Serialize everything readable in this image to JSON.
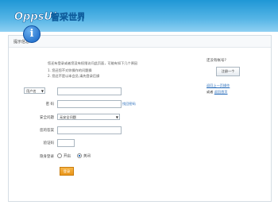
{
  "header": {
    "logo_text": "OppsU! 智采世界"
  },
  "panel": {
    "title": "提示信息"
  },
  "message": {
    "line1": "您还有登录或者您没有权限访问此页面，可能有如下几个原因",
    "line2": "1. 您还您不对你操作的问题操",
    "line3": "2. 您还不是以本会员,请先登录后操"
  },
  "form": {
    "user_type": "用户名",
    "password_label": "密    码",
    "forgot_link": "找回密码",
    "security_label": "安全问题",
    "security_value": "无安全问题",
    "answer_label": "您的答案",
    "captcha_label": "验证码",
    "stealth_label": "隐身登录",
    "radio_on": "开启",
    "radio_off": "关闭",
    "login_label": "登录"
  },
  "sidebar": {
    "no_account": "还没有帐号?",
    "register_label": "注册一个",
    "back_link": "返回上一页操作",
    "or_text": "或者",
    "home_link": "返回首页"
  }
}
